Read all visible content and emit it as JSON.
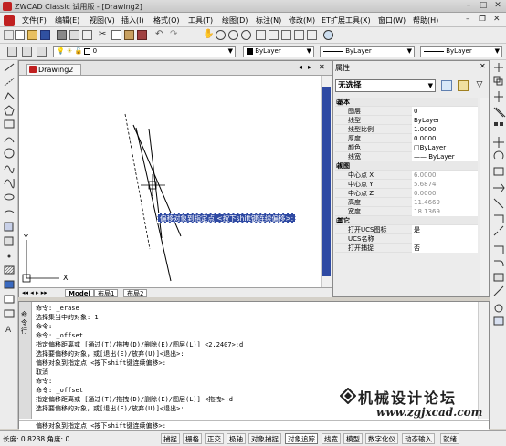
{
  "titlebar": {
    "title": "ZWCAD Classic 试用版 - [Drawing2]",
    "min": "–",
    "max": "□",
    "close": "✕"
  },
  "menu": {
    "items": [
      "文件(F)",
      "编辑(E)",
      "视图(V)",
      "插入(I)",
      "格式(O)",
      "工具(T)",
      "绘图(D)",
      "标注(N)",
      "修改(M)",
      "ET扩展工具(X)",
      "窗口(W)",
      "帮助(H)"
    ],
    "min": "–",
    "restore": "❐",
    "close": "✕"
  },
  "layer_toolbar": {
    "layer_value": "0",
    "color_value": "ByLayer",
    "linetype_value": "ByLayer",
    "lineweight_value": "ByLayer"
  },
  "document": {
    "tab_label": "Drawing2",
    "tab_controls": [
      "◂",
      "▸",
      "✕"
    ],
    "ucs_x": "X",
    "ucs_y": "Y",
    "layout_tabs": [
      "Model",
      "布局1",
      "布局2"
    ],
    "tooltip": "偏移对象到指定点 <按下shift键连续偏移>:"
  },
  "properties": {
    "header": "属性",
    "selection": "无选择",
    "sections": [
      {
        "title": "基本",
        "rows": [
          {
            "k": "图层",
            "v": "0"
          },
          {
            "k": "线型",
            "v": "ByLayer"
          },
          {
            "k": "线型比例",
            "v": "1.0000"
          },
          {
            "k": "厚度",
            "v": "0.0000"
          },
          {
            "k": "颜色",
            "v": "□ByLayer"
          },
          {
            "k": "线宽",
            "v": "—— ByLayer"
          }
        ]
      },
      {
        "title": "视图",
        "rows": [
          {
            "k": "中心点 X",
            "v": "6.0000"
          },
          {
            "k": "中心点 Y",
            "v": "5.6874"
          },
          {
            "k": "中心点 Z",
            "v": "0.0000"
          },
          {
            "k": "高度",
            "v": "11.4669"
          },
          {
            "k": "宽度",
            "v": "18.1369"
          }
        ]
      },
      {
        "title": "其它",
        "rows": [
          {
            "k": "打开UCS图标",
            "v": "是"
          },
          {
            "k": "UCS名称",
            "v": ""
          },
          {
            "k": "打开捕捉",
            "v": "否"
          }
        ]
      }
    ]
  },
  "command": {
    "side_label": "命令行",
    "lines": [
      "命令: _erase",
      "选择集当中的对象: 1",
      "命令:",
      "命令: _offset",
      "指定偏移距离或 [通过(T)/拖拽(D)/删除(E)/图层(L)] <2.2407>:d",
      "选择要偏移的对象，或[退出(E)/放弃(U)]<退出>:",
      "偏移对象到指定点 <按下shift键连续偏移>:",
      "取消",
      "命令:",
      "命令: _offset",
      "指定偏移距离或 [通过(T)/拖拽(D)/删除(E)/图层(L)] <拖拽>:d",
      "选择要偏移的对象，或[退出(E)/放弃(U)]<退出>:"
    ],
    "prompt": "偏移对象到指定点 <按下shift键连续偏移>:"
  },
  "watermark": {
    "line1": "机械设计论坛",
    "line2": "www.zgjxcad.com"
  },
  "status": {
    "coord": "长度: 0.8238 角度: 0",
    "buttons": [
      "捕捉",
      "栅格",
      "正交",
      "极轴",
      "对象捕捉",
      "对象追踪",
      "线宽",
      "模型",
      "数字化仪",
      "动态输入",
      "就绪"
    ],
    "active": [
      "对象追踪"
    ]
  }
}
